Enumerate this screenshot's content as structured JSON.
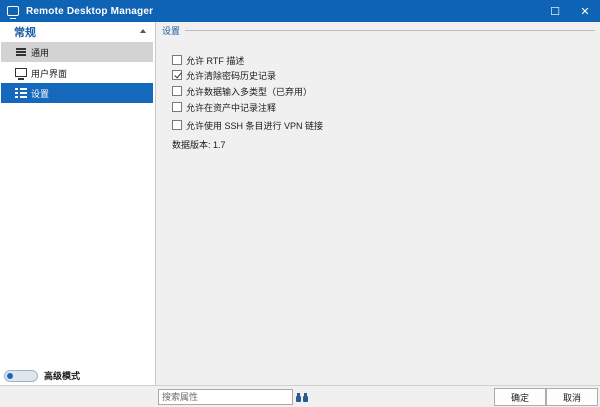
{
  "window": {
    "title": "Remote Desktop Manager",
    "maximize_glyph": "☐",
    "close_glyph": "✕"
  },
  "sidebar": {
    "group_title": "常规",
    "items": [
      {
        "label": "通用",
        "icon": "menu-icon",
        "state": "hover"
      },
      {
        "label": "用户界面",
        "icon": "monitor-icon",
        "state": "normal"
      },
      {
        "label": "设置",
        "icon": "list-settings-icon",
        "state": "selected"
      }
    ],
    "advanced_mode_label": "高级模式",
    "advanced_mode_on": false
  },
  "content": {
    "section_title": "设置",
    "options": [
      {
        "label": "允许 RTF 描述",
        "checked": false
      },
      {
        "label": "允许清除密码历史记录",
        "checked": true
      },
      {
        "label": "允许数据输入多类型（已弃用）",
        "checked": false
      },
      {
        "label": "允许在资产中记录注释",
        "checked": false
      },
      {
        "label": "允许使用 SSH 条目进行 VPN 链接",
        "checked": false
      }
    ],
    "data_version": "数据版本: 1.7"
  },
  "footer": {
    "search_placeholder": "搜索属性",
    "ok_label": "确定",
    "cancel_label": "取消"
  },
  "colors": {
    "titlebar": "#0e63b5",
    "accent": "#1d5ea8",
    "selected": "#1569bd",
    "hover": "#d3d3d3"
  }
}
